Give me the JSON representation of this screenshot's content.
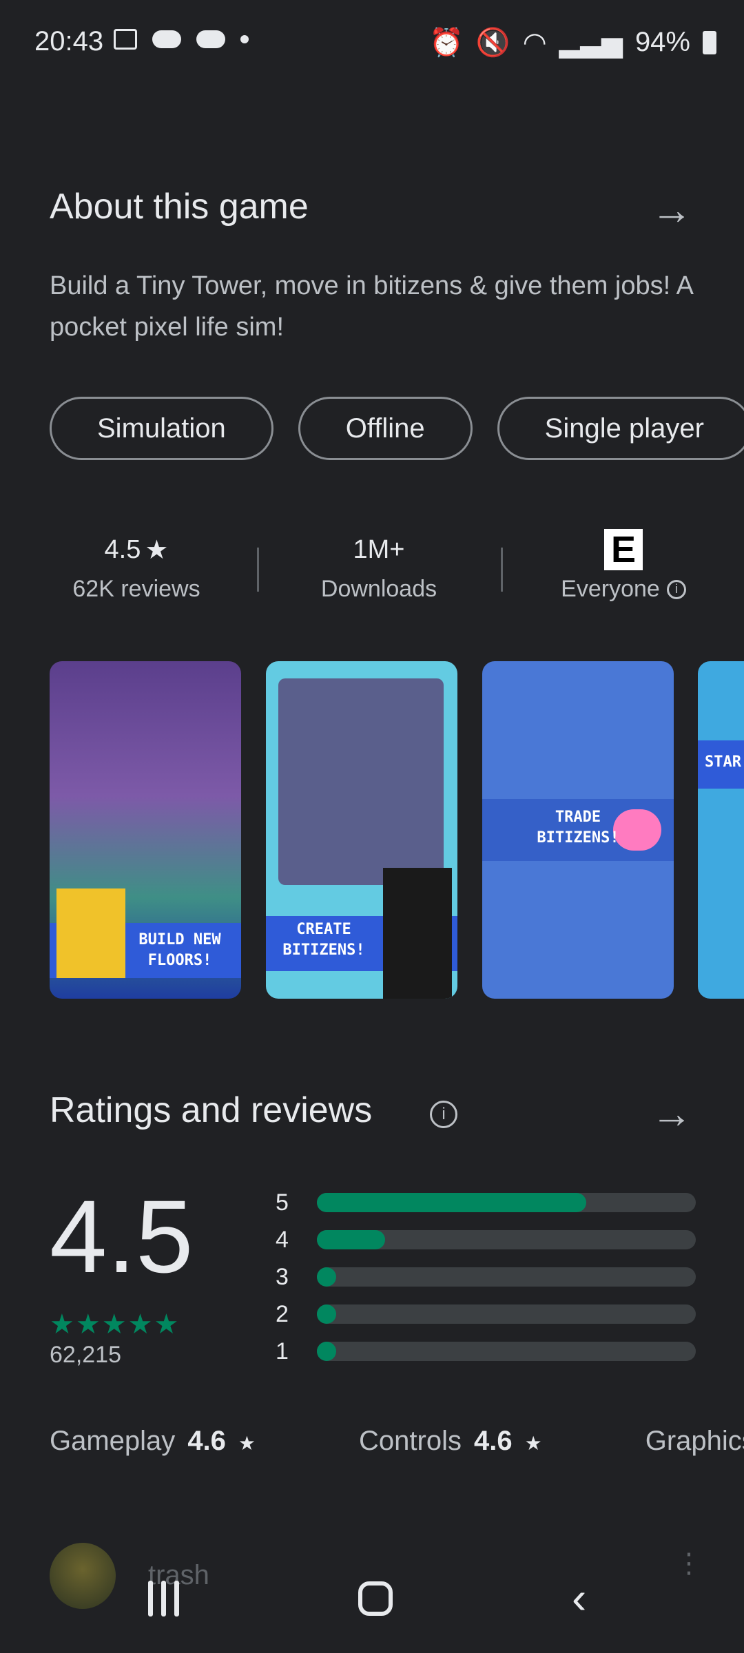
{
  "status_bar": {
    "time": "20:43",
    "battery": "94%",
    "left_icons": [
      "image-icon",
      "cloud-icon",
      "cloud-done-icon",
      "dot-icon"
    ],
    "right_icons": [
      "alarm-icon",
      "mute-icon",
      "wifi-icon",
      "signal-icon",
      "battery-icon"
    ]
  },
  "about": {
    "title": "About this game",
    "description": "Build a Tiny Tower, move in bitizens & give them jobs! A pocket pixel life sim!",
    "tags": [
      "Simulation",
      "Offline",
      "Single player"
    ]
  },
  "stats": {
    "rating": "4.5",
    "reviews": "62K reviews",
    "downloads": "1M+",
    "downloads_label": "Downloads",
    "content_rating_letter": "E",
    "content_rating": "Everyone"
  },
  "screenshots": [
    {
      "caption_line1": "BUILD NEW",
      "caption_line2": "FLOORS!",
      "bg": "#6a4fa0"
    },
    {
      "caption_line1": "CREATE",
      "caption_line2": "BITIZENS!",
      "bg": "#5fc8e0"
    },
    {
      "caption_line1": "TRADE",
      "caption_line2": "BITIZENS!",
      "bg": "#4a78d6"
    },
    {
      "caption_line1": "STAR",
      "caption_line2": "",
      "bg": "#3fa9e0"
    }
  ],
  "ratings": {
    "title": "Ratings and reviews",
    "average": "4.5",
    "total": "62,215",
    "stars_display": "★★★★★",
    "distribution": [
      {
        "star": "5",
        "fraction": 0.71
      },
      {
        "star": "4",
        "fraction": 0.18
      },
      {
        "star": "3",
        "fraction": 0.05
      },
      {
        "star": "2",
        "fraction": 0.05
      },
      {
        "star": "1",
        "fraction": 0.05
      }
    ]
  },
  "sub_ratings": [
    {
      "label": "Gameplay",
      "value": "4.6"
    },
    {
      "label": "Controls",
      "value": "4.6"
    },
    {
      "label": "Graphics",
      "value": ""
    }
  ],
  "review_preview": {
    "author": "trash"
  },
  "colors": {
    "background": "#202124",
    "accent_green": "#01875f"
  }
}
